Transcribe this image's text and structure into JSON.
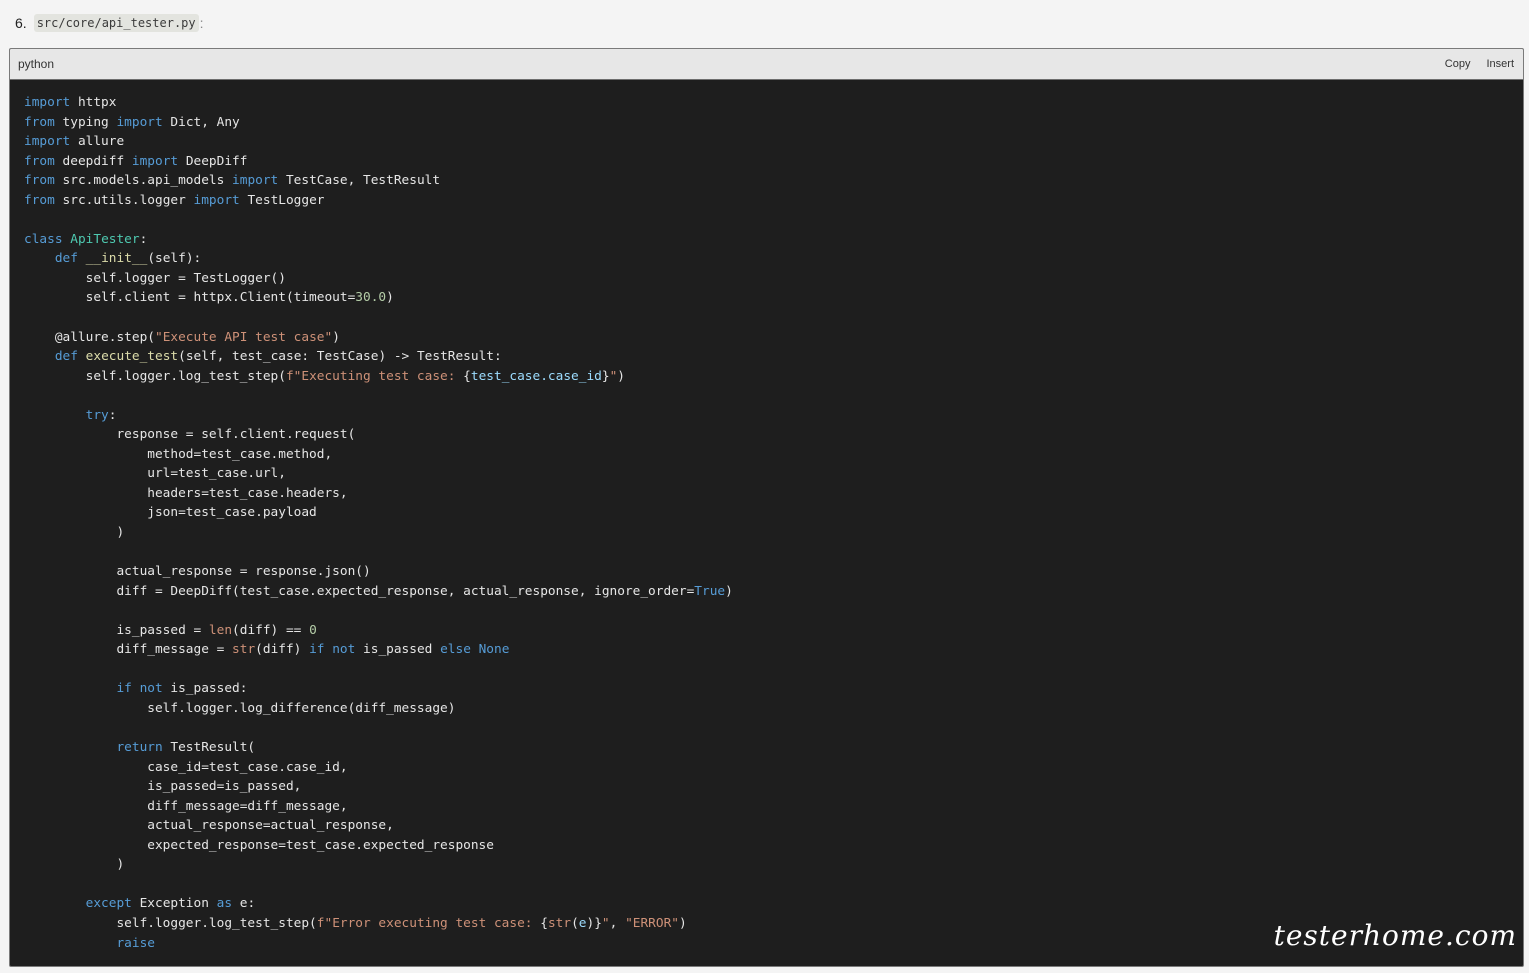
{
  "heading": {
    "number": "6.",
    "path": "src/core/api_tester.py",
    "colon": ":"
  },
  "code_block": {
    "language": "python",
    "copy_label": "Copy",
    "insert_label": "Insert",
    "lines": [
      [
        [
          "kw",
          "import"
        ],
        [
          "p",
          " httpx"
        ]
      ],
      [
        [
          "kw",
          "from"
        ],
        [
          "p",
          " typing "
        ],
        [
          "kw",
          "import"
        ],
        [
          "p",
          " Dict, Any"
        ]
      ],
      [
        [
          "kw",
          "import"
        ],
        [
          "p",
          " allure"
        ]
      ],
      [
        [
          "kw",
          "from"
        ],
        [
          "p",
          " deepdiff "
        ],
        [
          "kw",
          "import"
        ],
        [
          "p",
          " DeepDiff"
        ]
      ],
      [
        [
          "kw",
          "from"
        ],
        [
          "p",
          " src.models.api_models "
        ],
        [
          "kw",
          "import"
        ],
        [
          "p",
          " TestCase, TestResult"
        ]
      ],
      [
        [
          "kw",
          "from"
        ],
        [
          "p",
          " src.utils.logger "
        ],
        [
          "kw",
          "import"
        ],
        [
          "p",
          " TestLogger"
        ]
      ],
      [],
      [
        [
          "kw",
          "class"
        ],
        [
          "p",
          " "
        ],
        [
          "cls",
          "ApiTester"
        ],
        [
          "p",
          ":"
        ]
      ],
      [
        [
          "p",
          "    "
        ],
        [
          "kw",
          "def"
        ],
        [
          "p",
          " "
        ],
        [
          "fn",
          "__init__"
        ],
        [
          "p",
          "(self):"
        ]
      ],
      [
        [
          "p",
          "        self.logger = TestLogger()"
        ]
      ],
      [
        [
          "p",
          "        self.client = httpx.Client(timeout="
        ],
        [
          "num",
          "30.0"
        ],
        [
          "p",
          ")"
        ]
      ],
      [],
      [
        [
          "p",
          "    @allure.step("
        ],
        [
          "str",
          "\"Execute API test case\""
        ],
        [
          "p",
          ")"
        ]
      ],
      [
        [
          "p",
          "    "
        ],
        [
          "kw",
          "def"
        ],
        [
          "p",
          " "
        ],
        [
          "fn",
          "execute_test"
        ],
        [
          "p",
          "(self, test_case: TestCase) -> TestResult:"
        ]
      ],
      [
        [
          "p",
          "        self.logger.log_test_step("
        ],
        [
          "str",
          "f\"Executing test case: "
        ],
        [
          "p",
          "{"
        ],
        [
          "var",
          "test_case.case_id"
        ],
        [
          "p",
          "}"
        ],
        [
          "str",
          "\""
        ],
        [
          "p",
          ")"
        ]
      ],
      [],
      [
        [
          "p",
          "        "
        ],
        [
          "kw",
          "try"
        ],
        [
          "p",
          ":"
        ]
      ],
      [
        [
          "p",
          "            response = self.client.request("
        ]
      ],
      [
        [
          "p",
          "                method=test_case.method,"
        ]
      ],
      [
        [
          "p",
          "                url=test_case.url,"
        ]
      ],
      [
        [
          "p",
          "                headers=test_case.headers,"
        ]
      ],
      [
        [
          "p",
          "                json=test_case.payload"
        ]
      ],
      [
        [
          "p",
          "            )"
        ]
      ],
      [],
      [
        [
          "p",
          "            actual_response = response.json()"
        ]
      ],
      [
        [
          "p",
          "            diff = DeepDiff(test_case.expected_response, actual_response, ignore_order="
        ],
        [
          "kw",
          "True"
        ],
        [
          "p",
          ")"
        ]
      ],
      [],
      [
        [
          "p",
          "            is_passed = "
        ],
        [
          "str",
          "len"
        ],
        [
          "p",
          "(diff) == "
        ],
        [
          "num",
          "0"
        ]
      ],
      [
        [
          "p",
          "            diff_message = "
        ],
        [
          "str",
          "str"
        ],
        [
          "p",
          "(diff) "
        ],
        [
          "kw",
          "if not"
        ],
        [
          "p",
          " is_passed "
        ],
        [
          "kw",
          "else None"
        ]
      ],
      [],
      [
        [
          "p",
          "            "
        ],
        [
          "kw",
          "if not"
        ],
        [
          "p",
          " is_passed:"
        ]
      ],
      [
        [
          "p",
          "                self.logger.log_difference(diff_message)"
        ]
      ],
      [],
      [
        [
          "p",
          "            "
        ],
        [
          "kw",
          "return"
        ],
        [
          "p",
          " TestResult("
        ]
      ],
      [
        [
          "p",
          "                case_id=test_case.case_id,"
        ]
      ],
      [
        [
          "p",
          "                is_passed=is_passed,"
        ]
      ],
      [
        [
          "p",
          "                diff_message=diff_message,"
        ]
      ],
      [
        [
          "p",
          "                actual_response=actual_response,"
        ]
      ],
      [
        [
          "p",
          "                expected_response=test_case.expected_response"
        ]
      ],
      [
        [
          "p",
          "            )"
        ]
      ],
      [],
      [
        [
          "p",
          "        "
        ],
        [
          "kw",
          "except"
        ],
        [
          "p",
          " Exception "
        ],
        [
          "kw",
          "as"
        ],
        [
          "p",
          " e:"
        ]
      ],
      [
        [
          "p",
          "            self.logger.log_test_step("
        ],
        [
          "str",
          "f\"Error executing test case: "
        ],
        [
          "p",
          "{"
        ],
        [
          "str",
          "str"
        ],
        [
          "p",
          "("
        ],
        [
          "var",
          "e"
        ],
        [
          "p",
          ")}"
        ],
        [
          "str",
          "\""
        ],
        [
          "p",
          ", "
        ],
        [
          "str",
          "\"ERROR\""
        ],
        [
          "p",
          ")"
        ]
      ],
      [
        [
          "p",
          "            "
        ],
        [
          "kw",
          "raise"
        ]
      ]
    ]
  },
  "watermark": "testerhome.com",
  "colors": {
    "keyword": "#569cd6",
    "class_name": "#4ec9b0",
    "function": "#dcdcaa",
    "string": "#ce9178",
    "number": "#b5cea8",
    "variable": "#9cdcfe",
    "code_background": "#1e1e1e"
  }
}
